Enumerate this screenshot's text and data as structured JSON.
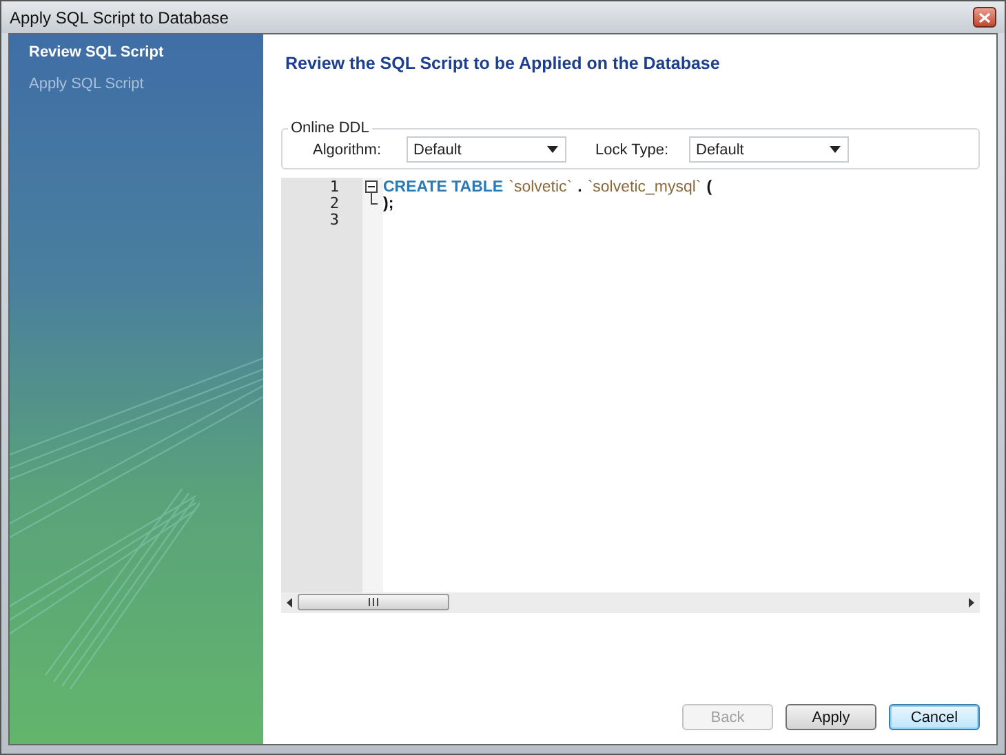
{
  "window": {
    "title": "Apply SQL Script to Database"
  },
  "steps": [
    {
      "label": "Review SQL Script",
      "selected": true
    },
    {
      "label": "Apply SQL Script",
      "selected": false
    }
  ],
  "heading": "Review the SQL Script to be Applied on the Database",
  "online_ddl": {
    "legend": "Online DDL",
    "fields": [
      {
        "label": "Algorithm:",
        "value": "Default"
      },
      {
        "label": "Lock Type:",
        "value": "Default"
      }
    ]
  },
  "editor": {
    "lines": [
      {
        "number": "1",
        "fold_open": true,
        "tokens": [
          {
            "kind": "keyword",
            "text": "CREATE TABLE"
          },
          {
            "kind": "identifier",
            "text": "`solvetic`"
          },
          {
            "kind": "punct",
            "text": "."
          },
          {
            "kind": "identifier",
            "text": "`solvetic_mysql`"
          },
          {
            "kind": "punct",
            "text": "("
          }
        ]
      },
      {
        "number": "2",
        "fold_end": true,
        "tokens": [
          {
            "kind": "punct",
            "text": ");"
          }
        ]
      },
      {
        "number": "3"
      }
    ]
  },
  "buttons": [
    {
      "label": "Back",
      "disabled": true,
      "focused": false
    },
    {
      "label": "Apply",
      "disabled": false,
      "focused": false
    },
    {
      "label": "Cancel",
      "disabled": false,
      "focused": true
    }
  ]
}
